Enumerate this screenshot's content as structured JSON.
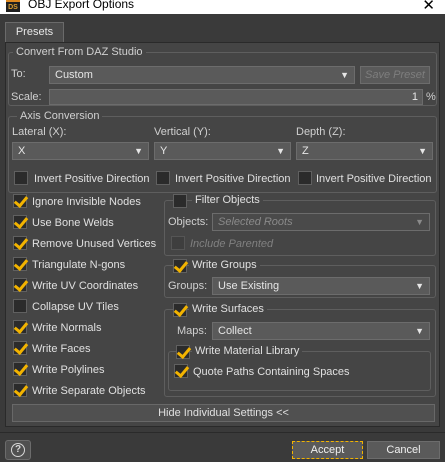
{
  "window": {
    "title": "OBJ Export Options",
    "close_glyph": "✕",
    "app_icon_text": "DS"
  },
  "tabs": [
    {
      "label": "Presets"
    }
  ],
  "convert_from": {
    "title": "Convert From DAZ Studio",
    "to_label": "To:",
    "to_value": "Custom",
    "save_preset_label": "Save Preset",
    "scale_label": "Scale:",
    "scale_value": "1",
    "scale_unit": "%"
  },
  "axis_conversion": {
    "title": "Axis Conversion",
    "lateral_label": "Lateral (X):",
    "lateral_value": "X",
    "vertical_label": "Vertical (Y):",
    "vertical_value": "Y",
    "depth_label": "Depth (Z):",
    "depth_value": "Z",
    "invert_label": "Invert Positive Direction"
  },
  "left_options": [
    {
      "label": "Ignore Invisible Nodes",
      "checked": true
    },
    {
      "label": "Use Bone Welds",
      "checked": true
    },
    {
      "label": "Remove Unused Vertices",
      "checked": true
    },
    {
      "label": "Triangulate N-gons",
      "checked": true
    },
    {
      "label": "Write UV Coordinates",
      "checked": true
    },
    {
      "label": "Collapse UV Tiles",
      "checked": false
    },
    {
      "label": "Write Normals",
      "checked": true
    },
    {
      "label": "Write Faces",
      "checked": true
    },
    {
      "label": "Write Polylines",
      "checked": true
    },
    {
      "label": "Write Separate Objects",
      "checked": true
    }
  ],
  "filter_objects": {
    "label": "Filter Objects",
    "checked": false,
    "objects_label": "Objects:",
    "objects_value": "Selected Roots",
    "include_parented_label": "Include Parented"
  },
  "write_groups": {
    "label": "Write Groups",
    "checked": true,
    "groups_label": "Groups:",
    "groups_value": "Use Existing"
  },
  "write_surfaces": {
    "label": "Write Surfaces",
    "checked": true,
    "maps_label": "Maps:",
    "maps_value": "Collect",
    "material_library_label": "Write Material Library",
    "quote_paths_label": "Quote Paths Containing Spaces"
  },
  "buttons": {
    "hide_settings": "Hide Individual Settings <<",
    "help": "?",
    "accept": "Accept",
    "cancel": "Cancel"
  },
  "colors": {
    "accent": "#f2b300",
    "panel": "#454545",
    "background": "#3a3a3a"
  }
}
